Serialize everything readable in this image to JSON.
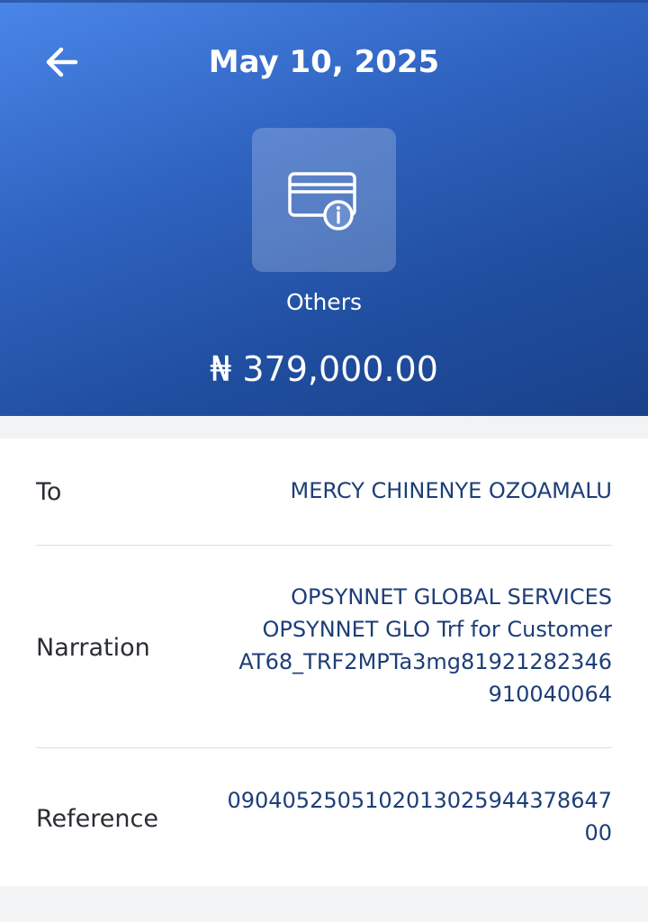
{
  "header": {
    "date": "May 10, 2025",
    "category": "Others",
    "amount": "₦ 379,000.00"
  },
  "icons": {
    "back": "arrow-left-icon",
    "category": "card-info-icon"
  },
  "details": {
    "to": {
      "label": "To",
      "value": "MERCY CHINENYE OZOAMALU"
    },
    "narration": {
      "label": "Narration",
      "lines": [
        "OPSYNNET GLOBAL SERVICES",
        "OPSYNNET GLO Trf for Customer",
        "AT68_TRF2MPTa3mg81921282346",
        "910040064"
      ]
    },
    "reference": {
      "label": "Reference",
      "lines": [
        "0904052505102013025944378647",
        "00"
      ]
    }
  },
  "colors": {
    "header_gradient_start": "#4a86e8",
    "header_gradient_end": "#1a418a",
    "value_text": "#1d3e78",
    "label_text": "#2a2d33",
    "page_background": "#f2f3f5"
  }
}
